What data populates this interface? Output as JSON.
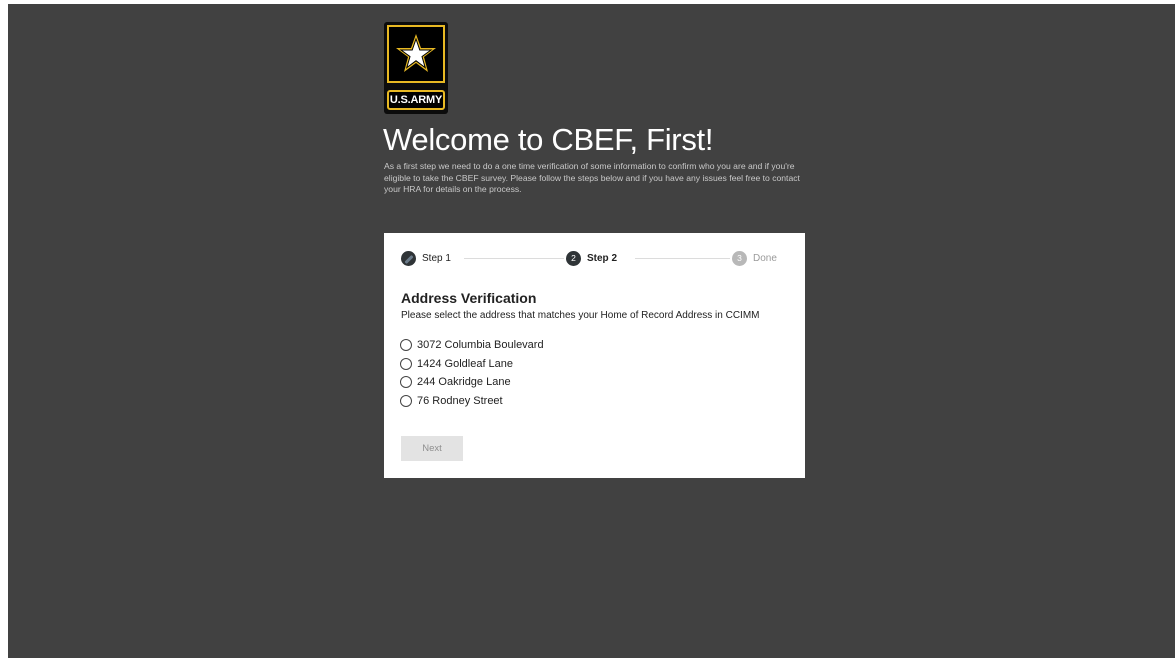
{
  "logo": {
    "icon": "star-icon",
    "wordmark": "U.S.ARMY",
    "colors": {
      "gold": "#e8b923",
      "black": "#000000"
    }
  },
  "page": {
    "title": "Welcome to CBEF, First!",
    "intro": "As a first step we need to do a one time verification of some information to confirm who you are and if you're eligible to take the CBEF survey. Please follow the steps below and if you have any issues feel free to contact your HRA for details on the process."
  },
  "stepper": {
    "steps": [
      {
        "number": "",
        "label": "Step 1",
        "status": "completed",
        "icon": "check-icon"
      },
      {
        "number": "2",
        "label": "Step 2",
        "status": "active"
      },
      {
        "number": "3",
        "label": "Done",
        "status": "inactive"
      }
    ]
  },
  "form": {
    "title": "Address Verification",
    "description": "Please select the address that matches your Home of Record Address in CCIMM",
    "options": [
      "3072 Columbia Boulevard",
      "1424 Goldleaf Lane",
      "244 Oakridge Lane",
      "76 Rodney Street"
    ],
    "selected": null,
    "next_label": "Next",
    "next_disabled": true
  },
  "colors": {
    "background": "#414141",
    "card": "#ffffff",
    "step_active": "#2f3437",
    "step_inactive": "#b8b8b8"
  }
}
